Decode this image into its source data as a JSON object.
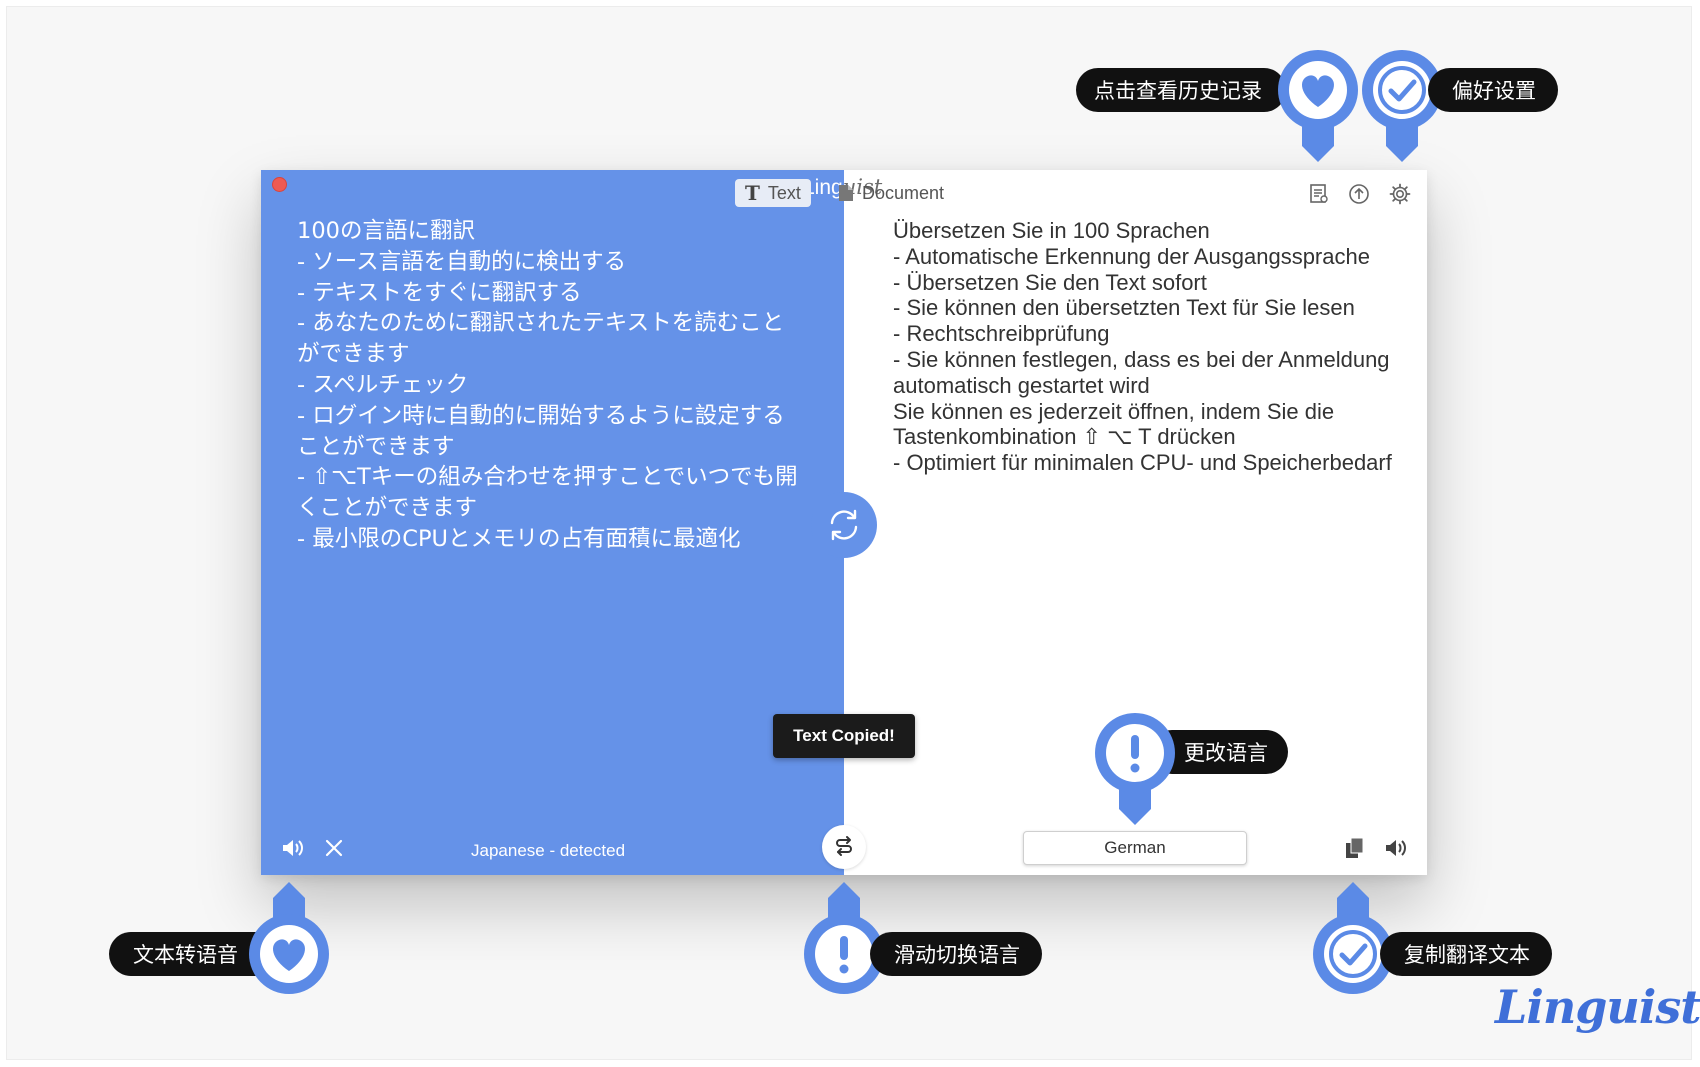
{
  "app": {
    "title_prefix": "Ling",
    "title_suffix": "uist",
    "brand_logo": "Linguist",
    "accent_color": "#6592e8",
    "marker_color": "#5b8ae6"
  },
  "toolbar": {
    "tab_text": "Text",
    "tab_document": "Document",
    "icons": [
      "history-icon",
      "share-icon",
      "gear-icon"
    ]
  },
  "source": {
    "text": "100の言語に翻訳\n- ソース言語を自動的に検出する\n- テキストをすぐに翻訳する\n- あなたのために翻訳されたテキストを読むこと\nができます\n- スペルチェック\n- ログイン時に自動的に開始するように設定する\nことができます\n- ⇧⌥Tキーの組み合わせを押すことでいつでも開\nくことができます\n- 最小限のCPUとメモリの占有面積に最適化",
    "language_label": "Japanese - detected"
  },
  "target": {
    "text": "Übersetzen Sie in 100 Sprachen\n- Automatische Erkennung der Ausgangssprache\n- Übersetzen Sie den Text sofort\n- Sie können den übersetzten Text für Sie lesen\n- Rechtschreibprüfung\n- Sie können festlegen, dass es bei der Anmeldung\nautomatisch gestartet wird\nSie können es jederzeit öffnen, indem Sie die\nTastenkombination ⇧ ⌥ T drücken\n- Optimiert für minimalen CPU- und Speicherbedarf",
    "language": "German"
  },
  "toast": {
    "message": "Text Copied!"
  },
  "callouts": {
    "history": "点击查看历史记录",
    "preferences": "偏好设置",
    "change_language": "更改语言",
    "text_to_speech": "文本转语音",
    "swipe_switch": "滑动切换语言",
    "copy_translation": "复制翻译文本"
  }
}
